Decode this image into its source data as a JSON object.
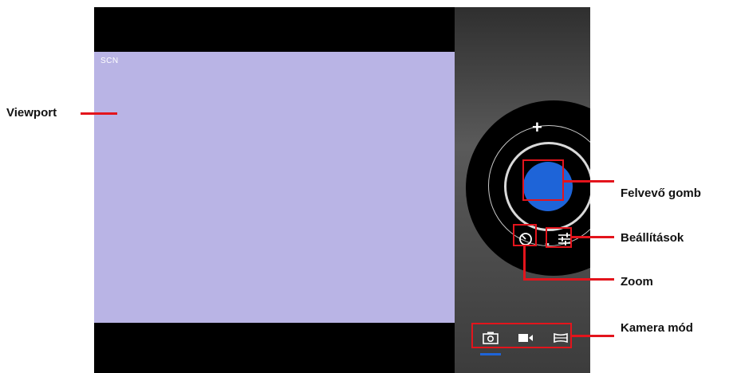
{
  "viewport": {
    "mode_label": "SCN"
  },
  "controls": {
    "zoom_in_symbol": "+",
    "zoom_out_symbol": "-",
    "record_button_color": "#1e64d8"
  },
  "camera_modes": {
    "items": [
      {
        "icon": "camera-icon"
      },
      {
        "icon": "video-icon"
      },
      {
        "icon": "panorama-icon"
      }
    ],
    "active_index": 0
  },
  "annotations": {
    "viewport": "Viewport",
    "record_button": "Felvevő gomb",
    "settings": "Beállítások",
    "zoom": "Zoom",
    "camera_mode": "Kamera mód"
  },
  "colors": {
    "callout": "#e3141c",
    "viewport_bg": "#b9b4e5",
    "accent": "#1e64d8"
  }
}
